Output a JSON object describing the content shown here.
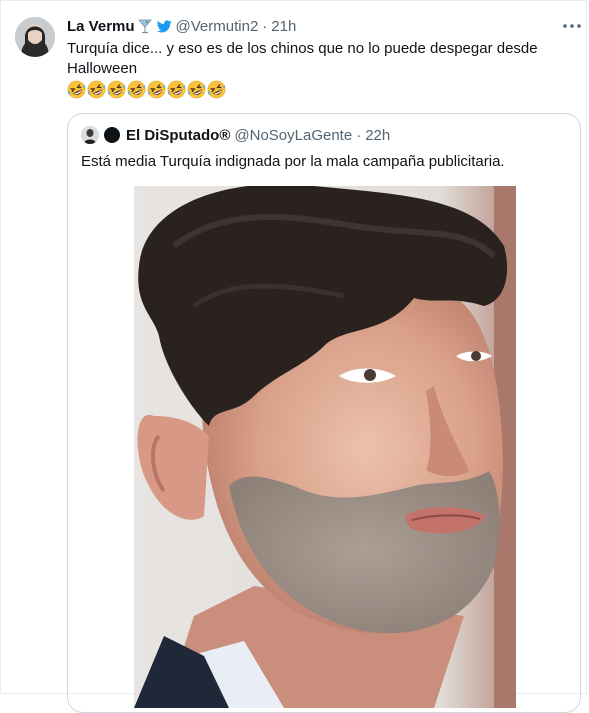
{
  "tweet": {
    "author_name": "La Vermu",
    "author_handle": "@Vermutin2",
    "separator": "·",
    "time": "21h",
    "text_line1": "Turquía dice... y eso es de los chinos que no lo puede despegar desde",
    "text_line2": "Halloween",
    "emoji_count": 8,
    "icons": [
      "martini-glass-icon",
      "bird-icon",
      "more-icon",
      "rolling-laughing-emoji"
    ]
  },
  "quote": {
    "author_name": "El DiSputado®",
    "author_handle": "@NoSoyLaGente",
    "separator": "·",
    "time": "22h",
    "text": "Está media Turquía indignada por la mala campaña publicitaria."
  },
  "colors": {
    "text": "#0f1419",
    "secondary": "#536471",
    "border": "#cfd9de",
    "bird": "#1d9bf0"
  }
}
